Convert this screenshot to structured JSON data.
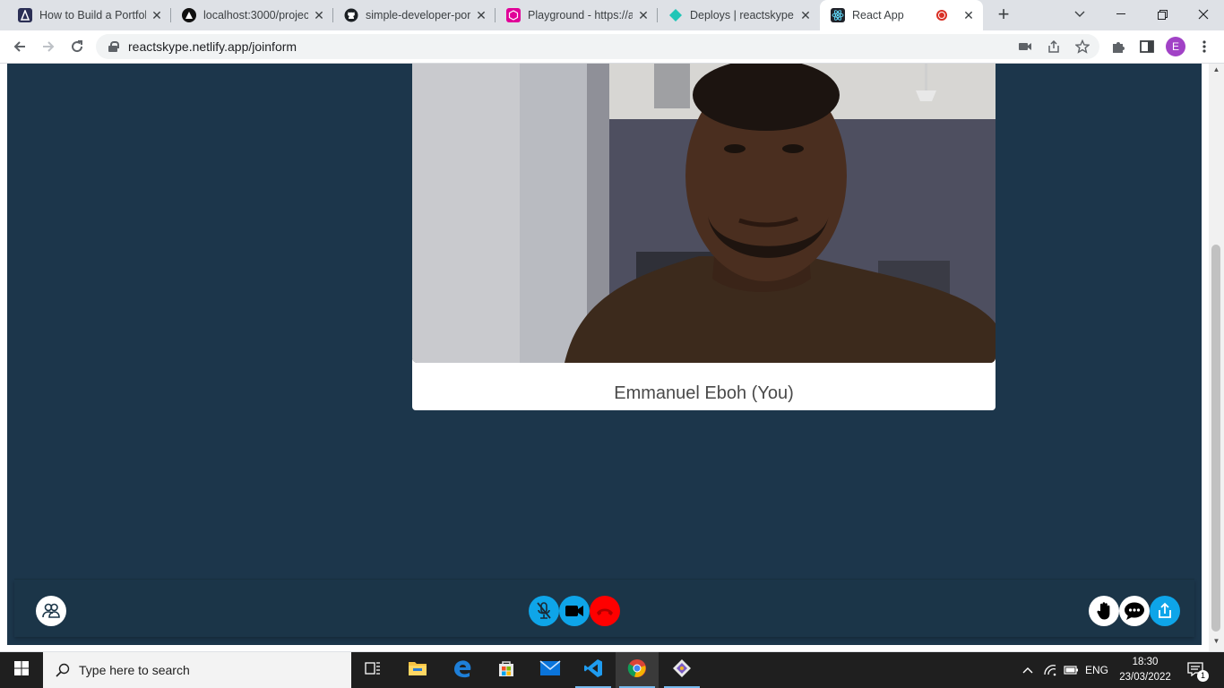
{
  "browser": {
    "tabs": [
      {
        "title": "How to Build a Portfol",
        "favicon": "astro-logo-icon",
        "active": false
      },
      {
        "title": "localhost:3000/project",
        "favicon": "triangle-logo-icon",
        "active": false
      },
      {
        "title": "simple-developer-por",
        "favicon": "github-icon",
        "active": false
      },
      {
        "title": "Playground - https://a",
        "favicon": "playground-icon",
        "active": false
      },
      {
        "title": "Deploys | reactskype",
        "favicon": "netlify-icon",
        "active": false
      },
      {
        "title": "React App",
        "favicon": "react-icon",
        "active": true,
        "recording": true
      }
    ],
    "address": "reactskype.netlify.app/joinform",
    "profile_initial": "E"
  },
  "call": {
    "participant_name": "Emmanuel Eboh (You)",
    "mic_muted": true,
    "controls": {
      "left": [
        "participants-icon"
      ],
      "center": [
        "mic-muted-icon",
        "video-camera-icon",
        "hang-up-icon"
      ],
      "right": [
        "raise-hand-icon",
        "chat-icon",
        "share-screen-icon"
      ]
    }
  },
  "taskbar": {
    "search_placeholder": "Type here to search",
    "language": "ENG",
    "time": "18:30",
    "date": "23/03/2022",
    "notification_count": "1"
  },
  "colors": {
    "page_background": "#1c364b",
    "control_bar": "#1b3548",
    "accent_blue": "#0ea5e9",
    "hang_up_red": "#ff0000"
  }
}
